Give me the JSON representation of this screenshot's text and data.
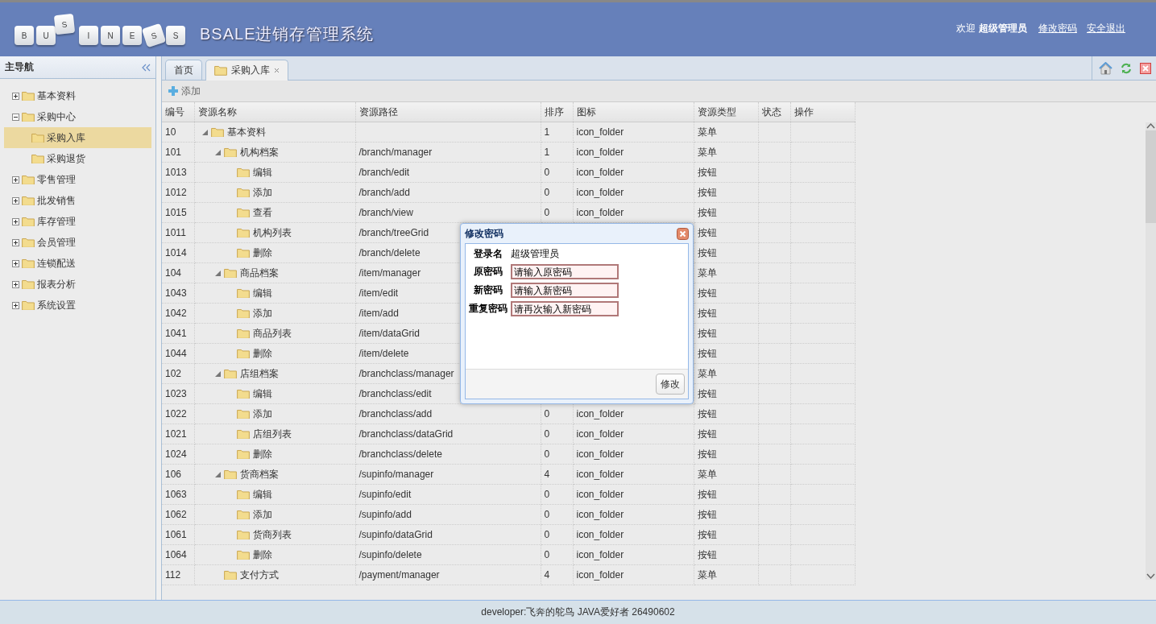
{
  "header": {
    "logo_keys": [
      {
        "letter": "B",
        "kind": "key"
      },
      {
        "letter": "U",
        "kind": "key"
      },
      {
        "letter": "S",
        "kind": "lifted"
      },
      {
        "letter": "I",
        "kind": "key"
      },
      {
        "letter": "N",
        "kind": "key"
      },
      {
        "letter": "E",
        "kind": "key"
      },
      {
        "letter": "S",
        "kind": "tilted"
      },
      {
        "letter": "S",
        "kind": "key"
      }
    ],
    "title": "BSALE进销存管理系统",
    "welcome": "欢迎",
    "user": "超级管理员",
    "links": [
      "修改密码",
      "安全退出"
    ]
  },
  "sidebar": {
    "title": "主导航",
    "items": [
      {
        "label": "基本资料",
        "expanded": false,
        "selected": false
      },
      {
        "label": "采购中心",
        "expanded": true,
        "selected": false,
        "children": [
          {
            "label": "采购入库",
            "selected": true
          },
          {
            "label": "采购退货",
            "selected": false
          }
        ]
      },
      {
        "label": "零售管理",
        "expanded": false,
        "selected": false
      },
      {
        "label": "批发销售",
        "expanded": false,
        "selected": false
      },
      {
        "label": "库存管理",
        "expanded": false,
        "selected": false
      },
      {
        "label": "会员管理",
        "expanded": false,
        "selected": false
      },
      {
        "label": "连锁配送",
        "expanded": false,
        "selected": false
      },
      {
        "label": "报表分析",
        "expanded": false,
        "selected": false
      },
      {
        "label": "系统设置",
        "expanded": false,
        "selected": false
      }
    ]
  },
  "tabs": [
    {
      "label": "首页",
      "selected": false,
      "closable": false
    },
    {
      "label": "采购入库",
      "selected": true,
      "closable": true
    }
  ],
  "toolbar": {
    "add": "添加"
  },
  "table": {
    "columns": [
      "编号",
      "资源名称",
      "资源路径",
      "排序",
      "图标",
      "资源类型",
      "状态",
      "操作"
    ],
    "rows": [
      {
        "id": "10",
        "name": "基本资料",
        "sort": "1",
        "icon": "icon_folder",
        "type": "菜单",
        "expanded": true,
        "children": [
          {
            "id": "101",
            "name": "机构档案",
            "path": "/branch/manager",
            "sort": "1",
            "icon": "icon_folder",
            "type": "菜单",
            "expanded": true,
            "children": [
              {
                "id": "1013",
                "name": "编辑",
                "path": "/branch/edit",
                "sort": "0",
                "icon": "icon_folder",
                "type": "按钮"
              },
              {
                "id": "1012",
                "name": "添加",
                "path": "/branch/add",
                "sort": "0",
                "icon": "icon_folder",
                "type": "按钮"
              },
              {
                "id": "1015",
                "name": "查看",
                "path": "/branch/view",
                "sort": "0",
                "icon": "icon_folder",
                "type": "按钮"
              },
              {
                "id": "1011",
                "name": "机构列表",
                "path": "/branch/treeGrid",
                "type": "按钮"
              },
              {
                "id": "1014",
                "name": "删除",
                "path": "/branch/delete",
                "type": "按钮"
              }
            ]
          },
          {
            "id": "104",
            "name": "商品档案",
            "path": "/item/manager",
            "type": "菜单",
            "expanded": true,
            "children": [
              {
                "id": "1043",
                "name": "编辑",
                "path": "/item/edit",
                "type": "按钮"
              },
              {
                "id": "1042",
                "name": "添加",
                "path": "/item/add",
                "type": "按钮"
              },
              {
                "id": "1041",
                "name": "商品列表",
                "path": "/item/dataGrid",
                "type": "按钮"
              },
              {
                "id": "1044",
                "name": "删除",
                "path": "/item/delete",
                "type": "按钮"
              }
            ]
          },
          {
            "id": "102",
            "name": "店组档案",
            "path": "/branchclass/manager",
            "type": "菜单",
            "expanded": true,
            "children": [
              {
                "id": "1023",
                "name": "编辑",
                "path": "/branchclass/edit",
                "type": "按钮"
              },
              {
                "id": "1022",
                "name": "添加",
                "path": "/branchclass/add",
                "sort": "0",
                "icon": "icon_folder",
                "type": "按钮"
              },
              {
                "id": "1021",
                "name": "店组列表",
                "path": "/branchclass/dataGrid",
                "sort": "0",
                "icon": "icon_folder",
                "type": "按钮"
              },
              {
                "id": "1024",
                "name": "删除",
                "path": "/branchclass/delete",
                "sort": "0",
                "icon": "icon_folder",
                "type": "按钮"
              }
            ]
          },
          {
            "id": "106",
            "name": "货商档案",
            "path": "/supinfo/manager",
            "sort": "4",
            "icon": "icon_folder",
            "type": "菜单",
            "expanded": true,
            "children": [
              {
                "id": "1063",
                "name": "编辑",
                "path": "/supinfo/edit",
                "sort": "0",
                "icon": "icon_folder",
                "type": "按钮"
              },
              {
                "id": "1062",
                "name": "添加",
                "path": "/supinfo/add",
                "sort": "0",
                "icon": "icon_folder",
                "type": "按钮"
              },
              {
                "id": "1061",
                "name": "货商列表",
                "path": "/supinfo/dataGrid",
                "sort": "0",
                "icon": "icon_folder",
                "type": "按钮"
              },
              {
                "id": "1064",
                "name": "删除",
                "path": "/supinfo/delete",
                "sort": "0",
                "icon": "icon_folder",
                "type": "按钮"
              }
            ]
          },
          {
            "id": "112",
            "name": "支付方式",
            "path": "/payment/manager",
            "sort": "4",
            "icon": "icon_folder",
            "type": "菜单"
          }
        ]
      }
    ]
  },
  "dialog": {
    "title": "修改密码",
    "fields": [
      {
        "kind": "text",
        "label": "登录名",
        "value": "超级管理员"
      },
      {
        "kind": "input",
        "label": "原密码",
        "placeholder": "请输入原密码"
      },
      {
        "kind": "input",
        "label": "新密码",
        "placeholder": "请输入新密码"
      },
      {
        "kind": "input",
        "label": "重复密码",
        "placeholder": "请再次输入新密码"
      }
    ],
    "button": "修改"
  },
  "footer": "developer:飞奔的鸵鸟 JAVA爱好者 26490602"
}
